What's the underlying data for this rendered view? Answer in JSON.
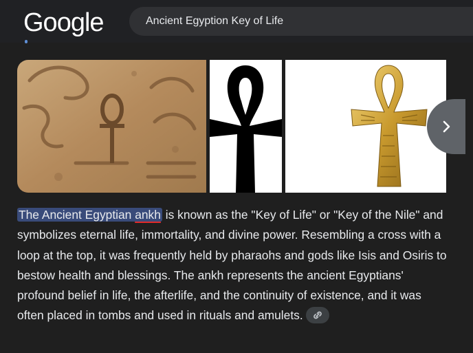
{
  "header": {
    "logo_text": "Google",
    "search_value": "Ancient Egyption Key of Life"
  },
  "images": [
    {
      "name": "hieroglyph-relief-ankh"
    },
    {
      "name": "black-ankh-symbol"
    },
    {
      "name": "gold-ankh-pendant"
    }
  ],
  "answer": {
    "highlight_a": "The Ancient Egyptian ",
    "highlight_b": "ankh",
    "body": " is known as the \"Key of Life\" or \"Key of the Nile\" and symbolizes eternal life, immortality, and divine power. Resembling a cross with a loop at the top, it was frequently held by pharaohs and gods like Isis and Osiris to bestow health and blessings. The ankh represents the ancient Egyptians' profound belief in life, the afterlife, and the continuity of existence, and it was often placed in tombs and used in rituals and amulets."
  },
  "icons": {
    "next": "chevron-right-icon",
    "link": "link-icon"
  },
  "colors": {
    "background": "#1f1f1f",
    "highlight": "#394b7a",
    "underline": "#e22a2a"
  }
}
